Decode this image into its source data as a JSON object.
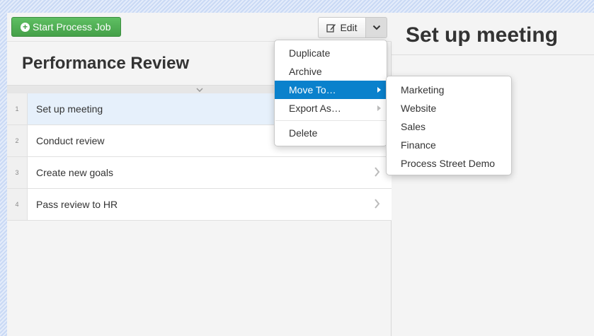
{
  "toolbar": {
    "start_label": "Start Process Job",
    "edit_label": "Edit"
  },
  "checklist": {
    "title": "Performance Review",
    "tasks": [
      {
        "num": "1",
        "label": "Set up meeting",
        "selected": true
      },
      {
        "num": "2",
        "label": "Conduct review"
      },
      {
        "num": "3",
        "label": "Create new goals"
      },
      {
        "num": "4",
        "label": "Pass review to HR"
      }
    ]
  },
  "detail": {
    "title": "Set up meeting"
  },
  "menu": {
    "items": [
      "Duplicate",
      "Archive",
      "Move To…",
      "Export As…",
      "Delete"
    ],
    "active": "Move To…"
  },
  "submenu": {
    "items": [
      "Marketing",
      "Website",
      "Sales",
      "Finance",
      "Process Street Demo"
    ]
  },
  "colors": {
    "start_green": "#45a049",
    "menu_active": "#0a81cc",
    "selected_row": "#e6f0fb"
  }
}
